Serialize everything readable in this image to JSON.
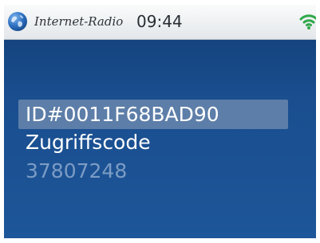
{
  "status_bar": {
    "app_icon": "globe-icon",
    "app_name": "Internet-Radio",
    "time": "09:44",
    "signal_icon": "wifi-icon"
  },
  "main": {
    "device_id": "ID#0011F68BAD90",
    "access_code_label": "Zugriffscode",
    "access_code_value": "37807248"
  },
  "colors": {
    "background_blue": "#1b4f90",
    "highlight": "#5d7ea8",
    "dim_text": "#7b9cc4",
    "wifi_green": "#2fa84a"
  }
}
